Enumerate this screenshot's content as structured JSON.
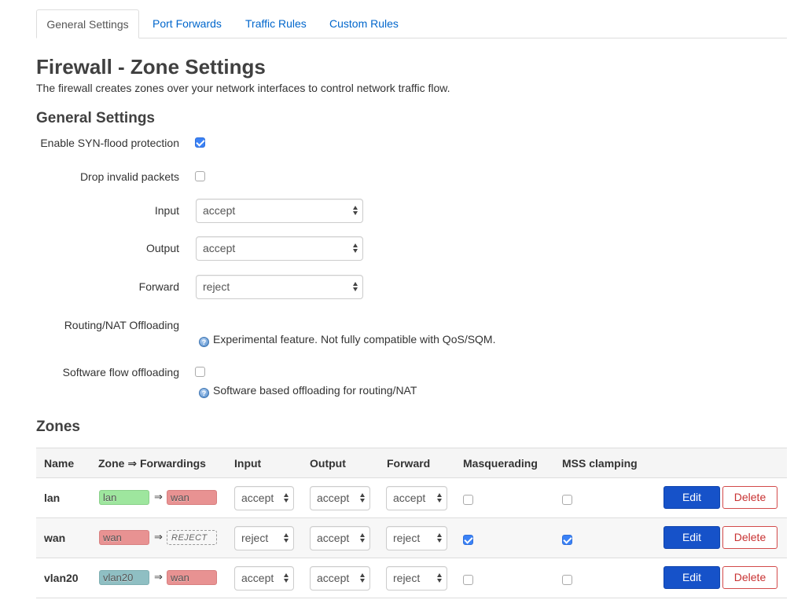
{
  "tabs": [
    "General Settings",
    "Port Forwards",
    "Traffic Rules",
    "Custom Rules"
  ],
  "page": {
    "title": "Firewall - Zone Settings",
    "description": "The firewall creates zones over your network interfaces to control network traffic flow."
  },
  "general": {
    "heading": "General Settings",
    "syn_flood_label": "Enable SYN-flood protection",
    "syn_flood_checked": true,
    "drop_invalid_label": "Drop invalid packets",
    "drop_invalid_checked": false,
    "input_label": "Input",
    "input_value": "accept",
    "output_label": "Output",
    "output_value": "accept",
    "forward_label": "Forward",
    "forward_value": "reject",
    "routing_nat_label": "Routing/NAT Offloading",
    "routing_nat_hint": "Experimental feature. Not fully compatible with QoS/SQM.",
    "sw_flow_label": "Software flow offloading",
    "sw_flow_checked": false,
    "sw_flow_hint": "Software based offloading for routing/NAT"
  },
  "zones": {
    "heading": "Zones",
    "columns": [
      "Name",
      "Zone ⇒ Forwardings",
      "Input",
      "Output",
      "Forward",
      "Masquerading",
      "MSS clamping"
    ],
    "edit_label": "Edit",
    "delete_label": "Delete",
    "rows": [
      {
        "name": "lan",
        "zone": "lan",
        "zone_color": "green",
        "forward_to": "wan",
        "forward_color": "red",
        "input": "accept",
        "output": "accept",
        "forward": "accept",
        "masq": false,
        "mss": false
      },
      {
        "name": "wan",
        "zone": "wan",
        "zone_color": "red",
        "forward_to": "REJECT",
        "forward_color": "reject",
        "input": "reject",
        "output": "accept",
        "forward": "reject",
        "masq": true,
        "mss": true
      },
      {
        "name": "vlan20",
        "zone": "vlan20",
        "zone_color": "teal",
        "forward_to": "wan",
        "forward_color": "red",
        "input": "accept",
        "output": "accept",
        "forward": "reject",
        "masq": false,
        "mss": false
      }
    ]
  },
  "colors": {
    "link": "#0066cc",
    "edit_button": "#1652c9",
    "delete_border": "#d34a4a",
    "checkbox_on": "#3b82f6"
  }
}
